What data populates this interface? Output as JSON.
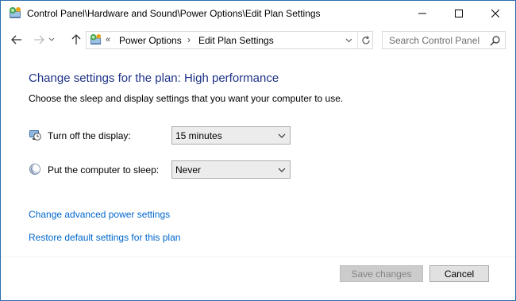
{
  "window": {
    "title": "Control Panel\\Hardware and Sound\\Power Options\\Edit Plan Settings"
  },
  "address_bar": {
    "overflow_chevron": "«",
    "crumbs": [
      "Power Options",
      "Edit Plan Settings"
    ],
    "separator": "›"
  },
  "search": {
    "placeholder": "Search Control Panel"
  },
  "content": {
    "heading": "Change settings for the plan: High performance",
    "subtext": "Choose the sleep and display settings that you want your computer to use.",
    "settings": [
      {
        "label": "Turn off the display:",
        "value": "15 minutes",
        "icon": "monitor-clock-icon"
      },
      {
        "label": "Put the computer to sleep:",
        "value": "Never",
        "icon": "moon-icon"
      }
    ],
    "links": [
      "Change advanced power settings",
      "Restore default settings for this plan"
    ]
  },
  "buttons": {
    "save": "Save changes",
    "cancel": "Cancel"
  },
  "colors": {
    "heading": "#1e3287",
    "link": "#0066cc",
    "window_border": "#2b6cb0"
  }
}
